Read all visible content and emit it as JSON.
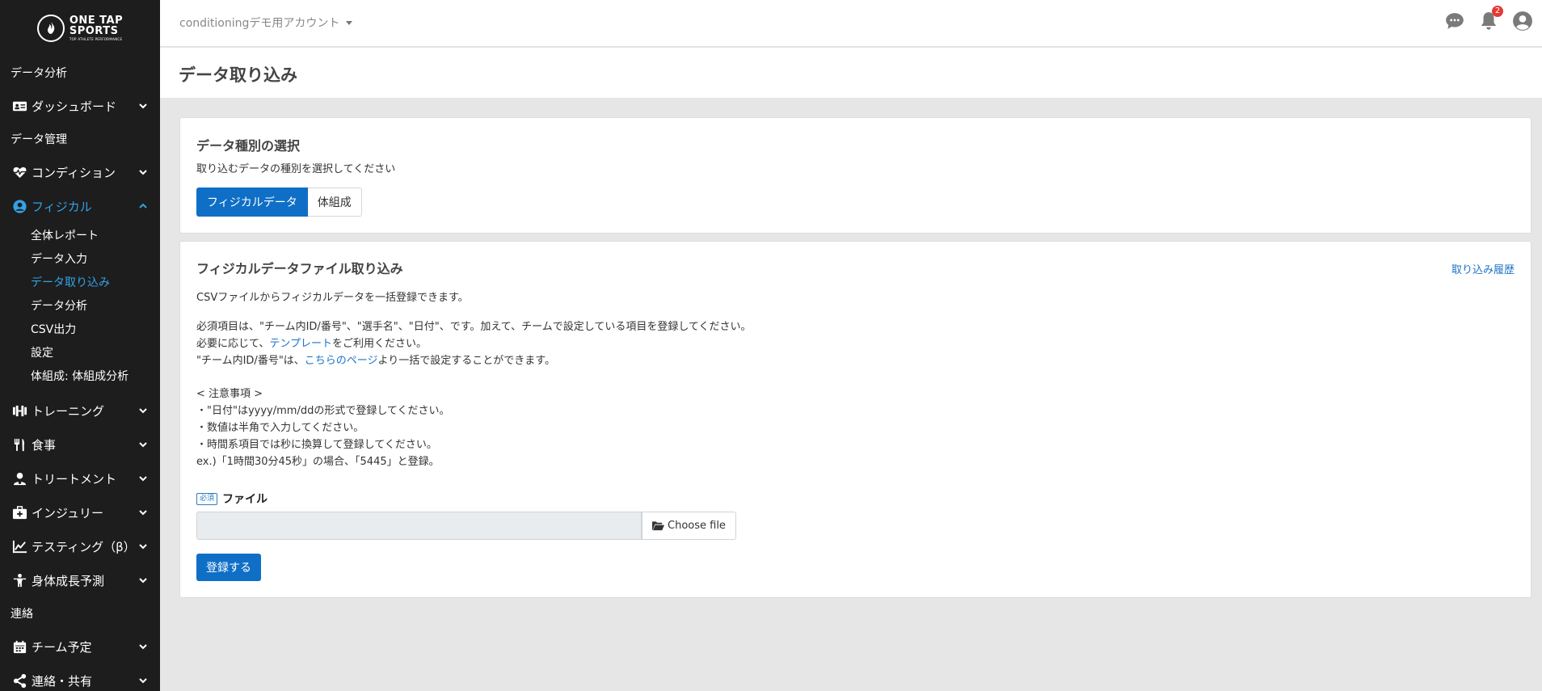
{
  "logo": {
    "line1": "ONE TAP",
    "line2": "SPORTS",
    "tagline": "TOP ATHLETE PERFORMANCE"
  },
  "sidebar": {
    "section_analysis": "データ分析",
    "dashboard": "ダッシュボード",
    "section_management": "データ管理",
    "condition": "コンディション",
    "physical": "フィジカル",
    "physical_sub": [
      "全体レポート",
      "データ入力",
      "データ取り込み",
      "データ分析",
      "CSV出力",
      "設定",
      "体組成: 体組成分析"
    ],
    "training": "トレーニング",
    "meal": "食事",
    "treatment": "トリートメント",
    "injury": "インジュリー",
    "testing": "テスティング（β）",
    "growth": "身体成長予測",
    "section_contact": "連絡",
    "team_schedule": "チーム予定",
    "share": "連絡・共有",
    "accent_color": "#33a2e6"
  },
  "topbar": {
    "account": "conditioningデモ用アカウント",
    "notification_count": "2",
    "icons": [
      "chat-icon",
      "bell-icon",
      "user-avatar-icon"
    ]
  },
  "page": {
    "title": "データ取り込み"
  },
  "type_card": {
    "title": "データ種別の選択",
    "subtitle": "取り込むデータの種別を選択してください",
    "options": [
      "フィジカルデータ",
      "体組成"
    ],
    "selected": "フィジカルデータ"
  },
  "import_card": {
    "title": "フィジカルデータファイル取り込み",
    "history_link": "取り込み履歴",
    "intro": "CSVファイルからフィジカルデータを一括登録できます。",
    "required_text": "必須項目は、\"チーム内ID/番号\"、\"選手名\"、\"日付\"、です。加えて、チームで設定している項目を登録してください。",
    "template_prefix": "必要に応じて、",
    "template_link": "テンプレート",
    "template_suffix": "をご利用ください。",
    "id_prefix": "\"チーム内ID/番号\"は、",
    "id_link": "こちらのページ",
    "id_suffix": "より一括で設定することができます。",
    "notes_title": "< 注意事項 >",
    "notes": [
      "・\"日付\"はyyyy/mm/ddの形式で登録してください。",
      "・数値は半角で入力してください。",
      "・時間系項目では秒に換算して登録してください。",
      "ex.)「1時間30分45秒」の場合、「5445」と登録。"
    ],
    "required_badge": "必須",
    "file_label": "ファイル",
    "choose_file": "Choose file",
    "submit": "登録する"
  }
}
